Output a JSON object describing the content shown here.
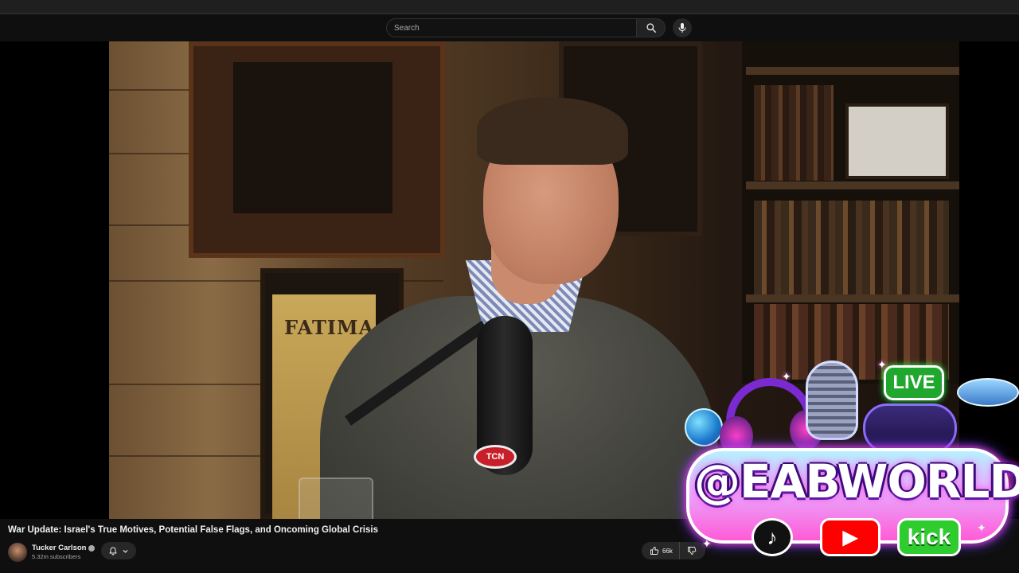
{
  "search": {
    "placeholder": "Search"
  },
  "video": {
    "poster_text": "FATIMA",
    "mic_badge": "TCN",
    "title": "War Update: Israel's True Motives, Potential False Flags, and Oncoming Global Crisis"
  },
  "channel": {
    "name": "Tucker Carlson",
    "subscribers": "5.32m subscribers"
  },
  "actions": {
    "likes": "66k"
  },
  "overlay": {
    "live_label": "LIVE",
    "handle": "@EABWORLD",
    "kick_label": "kick"
  },
  "icons": {
    "search": "search-icon",
    "mic": "microphone-icon",
    "bell": "bell-icon",
    "chevron": "chevron-down-icon",
    "like": "thumbs-up-icon",
    "dislike": "thumbs-down-icon"
  },
  "colors": {
    "background": "#0f0f0f",
    "text": "#f1f1f1",
    "secondary": "#aaaaaa",
    "button": "#272727"
  }
}
